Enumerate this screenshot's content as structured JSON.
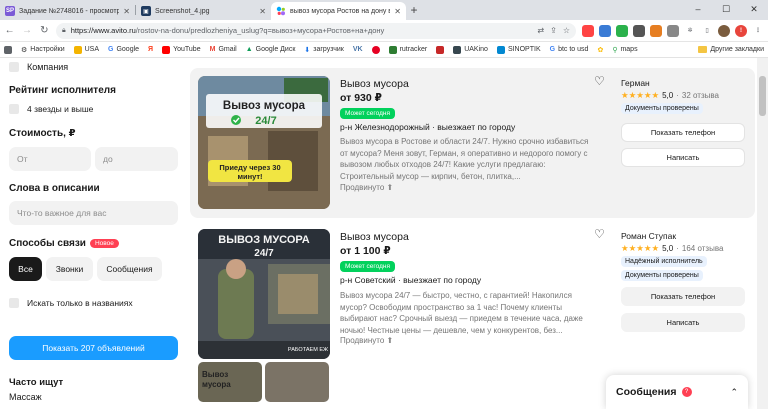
{
  "browser": {
    "tabs": [
      {
        "icon": "sp-icon",
        "icon_text": "SP",
        "icon_color": "#7b5ad6",
        "title": "Задание №2748016 - просмотр за",
        "active": false
      },
      {
        "icon": "screenshot-icon",
        "icon_text": "▣",
        "icon_color": "#1e3a5f",
        "title": "Screenshot_4.jpg",
        "active": false
      },
      {
        "icon": "avito-icon",
        "icon_text": "",
        "icon_color": "#00aaff",
        "title": "вывоз мусора Ростов на дону в Р",
        "active": true
      }
    ],
    "new_tab": "+",
    "url_host": "https://www.avito.ru",
    "url_path": "/rostov-na-donu/predlozheniya_uslug?q=вывоз+мусора+Ростов+на+дону",
    "window_controls": [
      "–",
      "☐",
      "✕"
    ]
  },
  "bookmarks": {
    "items": [
      "Настройки",
      "USA",
      "Google",
      "",
      "YouTube",
      "Gmail",
      "Google Диск",
      "загрузчик",
      "VK",
      "",
      "rutracker",
      "",
      "UAKino",
      "SINOPTIK",
      "btc to usd",
      "",
      "maps"
    ],
    "other": "Другие закладки"
  },
  "filters": {
    "company_label": "Компания",
    "rating_title": "Рейтинг исполнителя",
    "rating_option": "4 звезды и выше",
    "cost_title": "Стоимость, ₽",
    "cost_from_placeholder": "От",
    "cost_to_placeholder": "до",
    "words_title": "Слова в описании",
    "words_placeholder": "Что-то важное для вас",
    "contact_title": "Способы связи",
    "contact_badge": "Новое",
    "contact_options": [
      "Все",
      "Звонки",
      "Сообщения"
    ],
    "titles_only": "Искать только в названиях",
    "show_button": "Показать 207 объявлений",
    "often_title": "Часто ищут",
    "often_item": "Массаж"
  },
  "listings": [
    {
      "title": "Вывоз мусора",
      "price": "от 930 ₽",
      "today": "Может сегодня",
      "geo": "р-н Железнодорожный · выезжает по городу",
      "desc": "Вывоз мусора в Ростове и области 24/7. Нужно срочно избавиться от мусора? Меня зовут, Герман, я оперативно и недорого помогу с вывозом любых отходов 24/7! Какие услуги предлагаю: Строительный мусор — кирпич, бетон, плитка,...",
      "promo": "Продвинуто",
      "image_text_top": "Вывоз мусора",
      "image_text_mid": "24/7",
      "image_text_bottom": "Приеду через 30 минут!",
      "seller": "Герман",
      "rating": "5,0",
      "reviews": "32 отзыва",
      "tags": [
        "Документы проверены"
      ],
      "phone_btn": "Показать телефон",
      "write_btn": "Написать"
    },
    {
      "title": "Вывоз мусора",
      "price": "от 1 100 ₽",
      "today": "Может сегодня",
      "geo": "р-н Советский · выезжает по городу",
      "desc": "Вывоз мусора 24/7 — быстро, честно, с гарантией! Накопился мусор? Освободим пространство за 1 час! Почему клиенты выбирают нас? Срочный выезд — приедем в течение часа, даже ночью! Честные цены — дешевле, чем у конкурентов, без...",
      "promo": "Продвинуто",
      "image_text_top": "ВЫВОЗ МУСОРА",
      "image_text_mid": "24/7",
      "image_text_bottom": "РАБОТАЕМ ЕЖ",
      "thumb_text": "Вывоз мусора",
      "seller": "Роман Ступак",
      "rating": "5,0",
      "reviews": "164 отзыва",
      "tags": [
        "Надёжный исполнитель",
        "Документы проверены"
      ],
      "phone_btn": "Показать телефон",
      "write_btn": "Написать"
    }
  ],
  "messages": {
    "label": "Сообщения",
    "count": "?"
  }
}
